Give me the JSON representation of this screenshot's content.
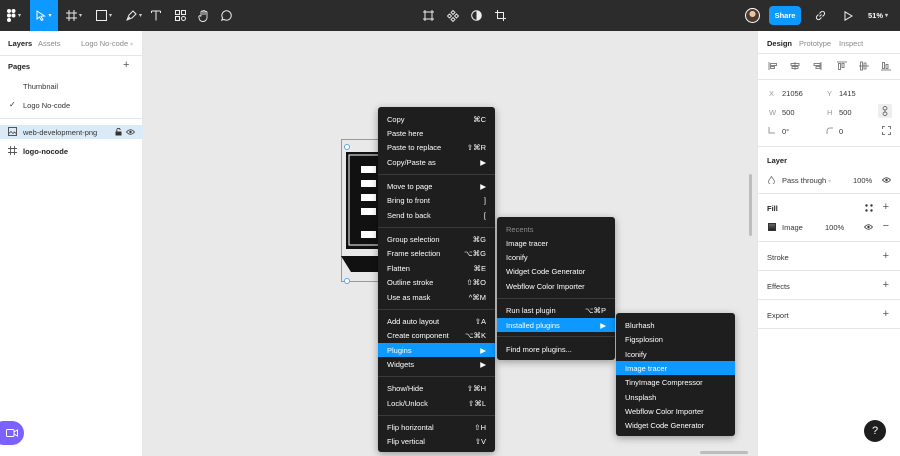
{
  "toolbar": {
    "share_label": "Share",
    "zoom": "51%",
    "icons": [
      "figma-menu-icon",
      "move-tool-icon",
      "frame-tool-icon",
      "shape-tool-icon",
      "pen-tool-icon",
      "text-tool-icon",
      "resources-icon",
      "hand-tool-icon",
      "comment-icon",
      "crop-frame-icon",
      "component-icon",
      "contrast-icon",
      "crop-icon",
      "link-icon",
      "play-icon"
    ]
  },
  "left": {
    "tabs": [
      "Layers",
      "Assets",
      "Logo No-code"
    ],
    "pages_title": "Pages",
    "pages": [
      "Thumbnail",
      "Logo No-code"
    ],
    "layers": [
      "web-development-png",
      "logo-nocode"
    ]
  },
  "right": {
    "tabs": [
      "Design",
      "Prototype",
      "Inspect"
    ],
    "x_label": "X",
    "x_value": "21056",
    "y_label": "Y",
    "y_value": "1415",
    "w_label": "W",
    "w_value": "500",
    "h_label": "H",
    "h_value": "500",
    "rotation": "0°",
    "radius": "0",
    "layer_title": "Layer",
    "blend": "Pass through",
    "opacity": "100%",
    "fill_title": "Fill",
    "fill_type": "Image",
    "fill_opacity": "100%",
    "stroke_title": "Stroke",
    "effects_title": "Effects",
    "export_title": "Export"
  },
  "context_menu": [
    {
      "label": "Copy",
      "shortcut": "⌘C"
    },
    {
      "label": "Paste here",
      "shortcut": ""
    },
    {
      "label": "Paste to replace",
      "shortcut": "⇧⌘R"
    },
    {
      "label": "Copy/Paste as",
      "shortcut": "▶"
    },
    {
      "label": "Move to page",
      "shortcut": "▶"
    },
    {
      "label": "Bring to front",
      "shortcut": "]"
    },
    {
      "label": "Send to back",
      "shortcut": "["
    },
    {
      "label": "Group selection",
      "shortcut": "⌘G"
    },
    {
      "label": "Frame selection",
      "shortcut": "⌥⌘G"
    },
    {
      "label": "Flatten",
      "shortcut": "⌘E"
    },
    {
      "label": "Outline stroke",
      "shortcut": "⇧⌘O"
    },
    {
      "label": "Use as mask",
      "shortcut": "^⌘M"
    },
    {
      "label": "Add auto layout",
      "shortcut": "⇧A"
    },
    {
      "label": "Create component",
      "shortcut": "⌥⌘K"
    },
    {
      "label": "Plugins",
      "shortcut": "▶"
    },
    {
      "label": "Widgets",
      "shortcut": "▶"
    },
    {
      "label": "Show/Hide",
      "shortcut": "⇧⌘H"
    },
    {
      "label": "Lock/Unlock",
      "shortcut": "⇧⌘L"
    },
    {
      "label": "Flip horizontal",
      "shortcut": "⇧H"
    },
    {
      "label": "Flip vertical",
      "shortcut": "⇧V"
    }
  ],
  "plugins_menu": {
    "recents_label": "Recents",
    "recents": [
      "Image tracer",
      "Iconify",
      "Widget Code Generator",
      "Webflow Color Importer"
    ],
    "run_last": "Run last plugin",
    "run_last_shortcut": "⌥⌘P",
    "installed": "Installed plugins",
    "installed_arrow": "▶",
    "find_more": "Find more plugins..."
  },
  "installed_menu": [
    "Blurhash",
    "Figsplosion",
    "Iconify",
    "Image tracer",
    "TinyImage Compressor",
    "Unsplash",
    "Webflow Color Importer",
    "Widget Code Generator"
  ],
  "help_label": "?"
}
